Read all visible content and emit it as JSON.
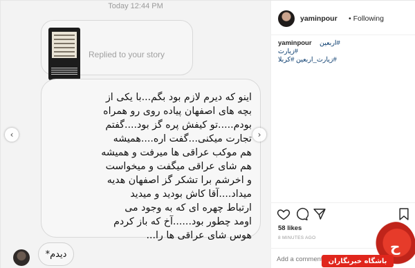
{
  "dm": {
    "timestamp": "Today 12:44 PM",
    "story_reply_label": "Replied to your story",
    "message": "اینو که دیرم لازم بود بگم...با یکی از\nبچه های اصفهان پیاده روی رو همراه\nبودم.....تو کیفش پره گز بود....گفتم\nتجارت میکنی...گفت اره....همیشه\nهم موکب عراقی ها میرفت و همیشه\nهم شای عراقی میگفت و میخواست\nو اخرشم برا تشکر گز اصفهان هدیه\nمیداد....آقا کاش بودید و میدید\nارتباط چهره ای که به وجود می\nاومد چطور بود......آخ که باز کردم\nهوس شای عراقی ها را...",
    "reply": "دیدم*"
  },
  "post": {
    "username": "yaminpour",
    "follow_label": "• Following",
    "caption_user": "yaminpour",
    "hashtags": [
      "#اربعین",
      "#زیارت",
      "#زیارت_اربعین #کربلا"
    ],
    "likes": "58 likes",
    "time_ago": "8 MINUTES AGO",
    "comment_placeholder": "Add a comment..."
  },
  "watermark": {
    "text": "باشگاه خبرنگاران",
    "glyph": "ح"
  },
  "icons": {
    "like": "heart-icon",
    "comment": "comment-icon",
    "share": "share-icon",
    "save": "bookmark-icon",
    "prev": "chevron-left-icon",
    "next": "chevron-right-icon"
  }
}
